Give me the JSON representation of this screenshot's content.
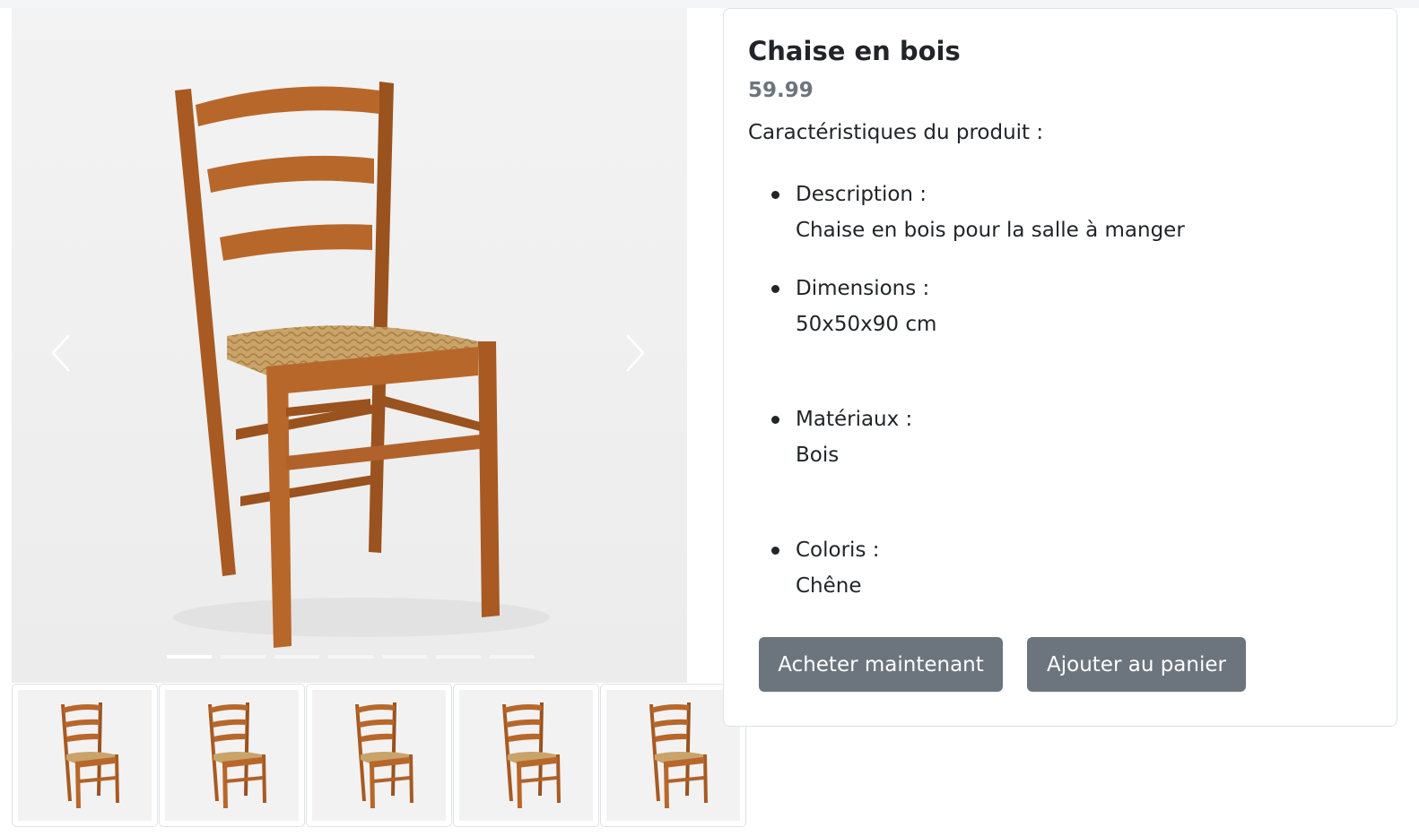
{
  "product": {
    "title": "Chaise en bois",
    "price": "59.99",
    "features_heading": "Caractéristiques du produit :",
    "features": [
      {
        "label": "Description :",
        "value": "Chaise en bois pour la salle à manger"
      },
      {
        "label": "Dimensions :",
        "value": "50x50x90 cm"
      },
      {
        "label": "Matériaux :",
        "value": "Bois"
      },
      {
        "label": "Coloris :",
        "value": "Chêne"
      }
    ]
  },
  "actions": {
    "buy_now": "Acheter maintenant",
    "add_to_cart": "Ajouter au panier"
  },
  "carousel": {
    "slide_count": 7,
    "active_index": 0,
    "thumbnail_count": 5
  },
  "colors": {
    "button_bg": "#6c757d",
    "price_text": "#6c757d",
    "wood": "#b5652a",
    "rush_seat": "#c9a36a"
  }
}
